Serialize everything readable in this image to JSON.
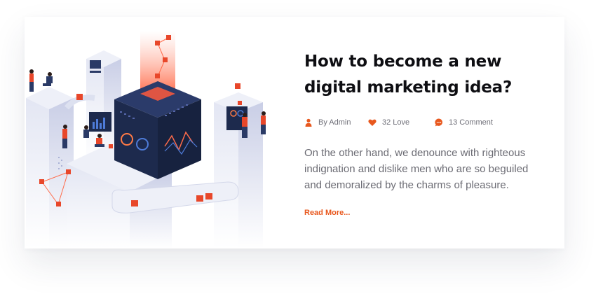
{
  "post": {
    "title": "How to become a new digital marketing idea?",
    "meta": {
      "author": "By Admin",
      "love": "32 Love",
      "comments": "13 Comment"
    },
    "excerpt": "On the other hand, we denounce with righteous indignation and dislike men who are so beguiled and demoralized by the charms of pleasure.",
    "read_more": "Read More..."
  },
  "icons": {
    "author": "user-icon",
    "love": "heart-icon",
    "comments": "comment-icon"
  },
  "colors": {
    "accent": "#e8581e",
    "title": "#0e0e12",
    "text": "#6b6b73",
    "illustration_dark": "#1d2a4d",
    "illustration_light": "#e3e6f3"
  }
}
